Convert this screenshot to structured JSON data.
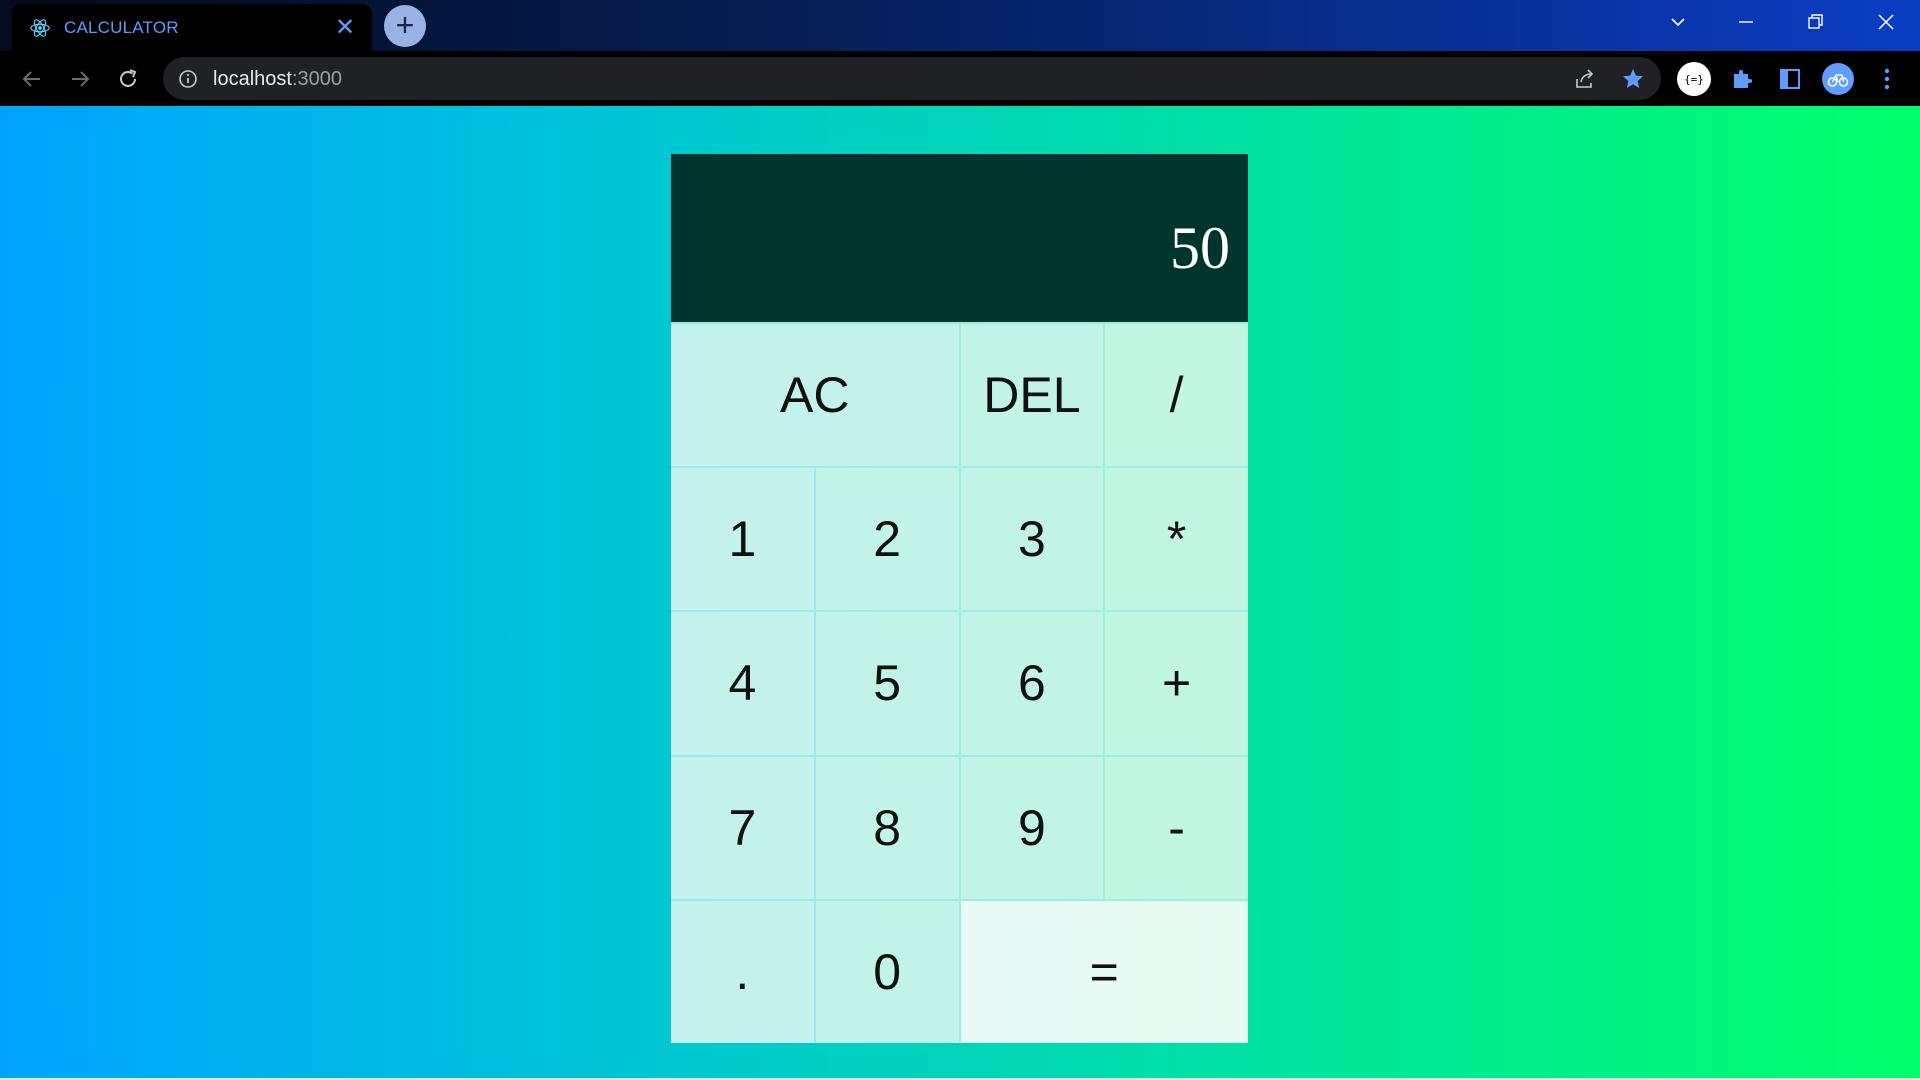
{
  "browser": {
    "tab": {
      "title": "CALCULATOR",
      "close_label": "✕"
    },
    "new_tab_label": "+",
    "address": {
      "host": "localhost",
      "port": ":3000"
    }
  },
  "calculator": {
    "display": "50",
    "keys": {
      "ac": "AC",
      "del": "DEL",
      "divide": "/",
      "one": "1",
      "two": "2",
      "three": "3",
      "multiply": "*",
      "four": "4",
      "five": "5",
      "six": "6",
      "plus": "+",
      "seven": "7",
      "eight": "8",
      "nine": "9",
      "minus": "-",
      "dot": ".",
      "zero": "0",
      "equals": "="
    }
  },
  "colors": {
    "display_bg": "#00342e",
    "key_bg": "#c3f1ec",
    "page_gradient_start": "#00a4ff",
    "page_gradient_end": "#00ff6a",
    "accent": "#5f9cff"
  }
}
